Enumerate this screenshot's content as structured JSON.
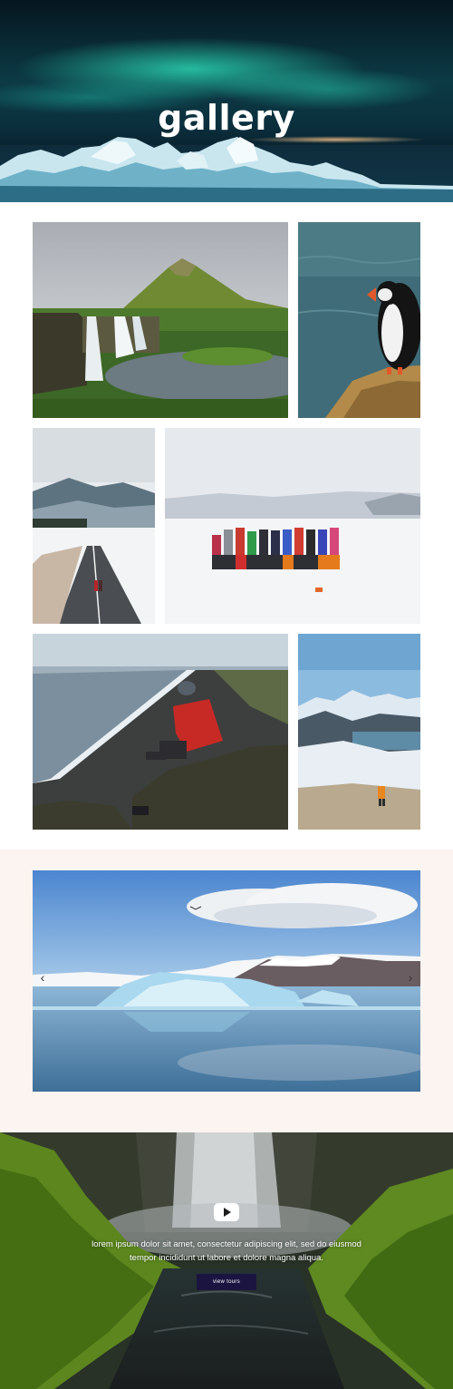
{
  "hero": {
    "title": "gallery",
    "image": "aurora-over-icebergs"
  },
  "gallery": {
    "photos": [
      {
        "name": "photo-kirkjufell-waterfall",
        "subject": "mountain-and-waterfall"
      },
      {
        "name": "photo-puffin",
        "subject": "puffin-on-cliff"
      },
      {
        "name": "photo-snowy-road",
        "subject": "couple-on-snowy-road"
      },
      {
        "name": "photo-glacier-group",
        "subject": "hiking-group-on-glacier"
      },
      {
        "name": "photo-black-sand-beach",
        "subject": "hiker-above-black-sand-beach"
      },
      {
        "name": "photo-mountain-valley",
        "subject": "hiker-in-mountain-valley"
      }
    ]
  },
  "slider": {
    "prev_icon": "chevron-left-icon",
    "next_icon": "chevron-right-icon",
    "prev_glyph": "‹",
    "next_glyph": "›",
    "current_slide": "glacier-lagoon"
  },
  "video": {
    "play_icon": "play-icon",
    "description": "lorem ipsum dolor sit amet, consectetur adipiscing elit, sed do eiusmod tempor incididunt ut labore et dolore magna aliqua.",
    "button_label": "view tours"
  },
  "colors": {
    "slider_background": "#fbf4f0",
    "button_background": "#1b1440",
    "text_light": "#ffffff"
  }
}
